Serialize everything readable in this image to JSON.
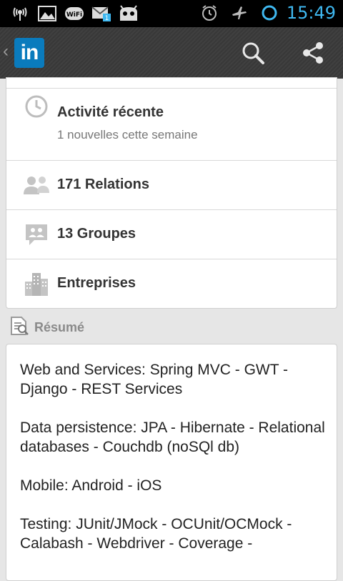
{
  "statusbar": {
    "time": "15:49",
    "left_icons": [
      "signal-icon",
      "image-icon",
      "wifi-icon",
      "message-icon",
      "android-icon"
    ],
    "right_icons": [
      "alarm-icon",
      "airplane-icon",
      "ring-icon"
    ]
  },
  "actionbar": {
    "logo_text": "in",
    "search_icon": "search-icon",
    "share_icon": "share-icon"
  },
  "profile_menu": {
    "activity": {
      "title": "Activité récente",
      "subtitle": "1 nouvelles cette semaine"
    },
    "relations": {
      "title": "171 Relations"
    },
    "groups": {
      "title": "13 Groupes"
    },
    "companies": {
      "title": "Entreprises"
    }
  },
  "summary": {
    "section_title": "Résumé",
    "paragraphs": [
      "Web and Services:  Spring MVC - GWT - Django - REST Services",
      "Data persistence: JPA - Hibernate - Relational databases - Couchdb (noSQl db)",
      "Mobile: Android - iOS",
      "Testing: JUnit/JMock - OCUnit/OCMock - Calabash - Webdriver - Coverage -"
    ]
  },
  "colors": {
    "brand": "#0a7bbd",
    "clock": "#3fb8f0",
    "actionbar": "#3a3a3a"
  }
}
